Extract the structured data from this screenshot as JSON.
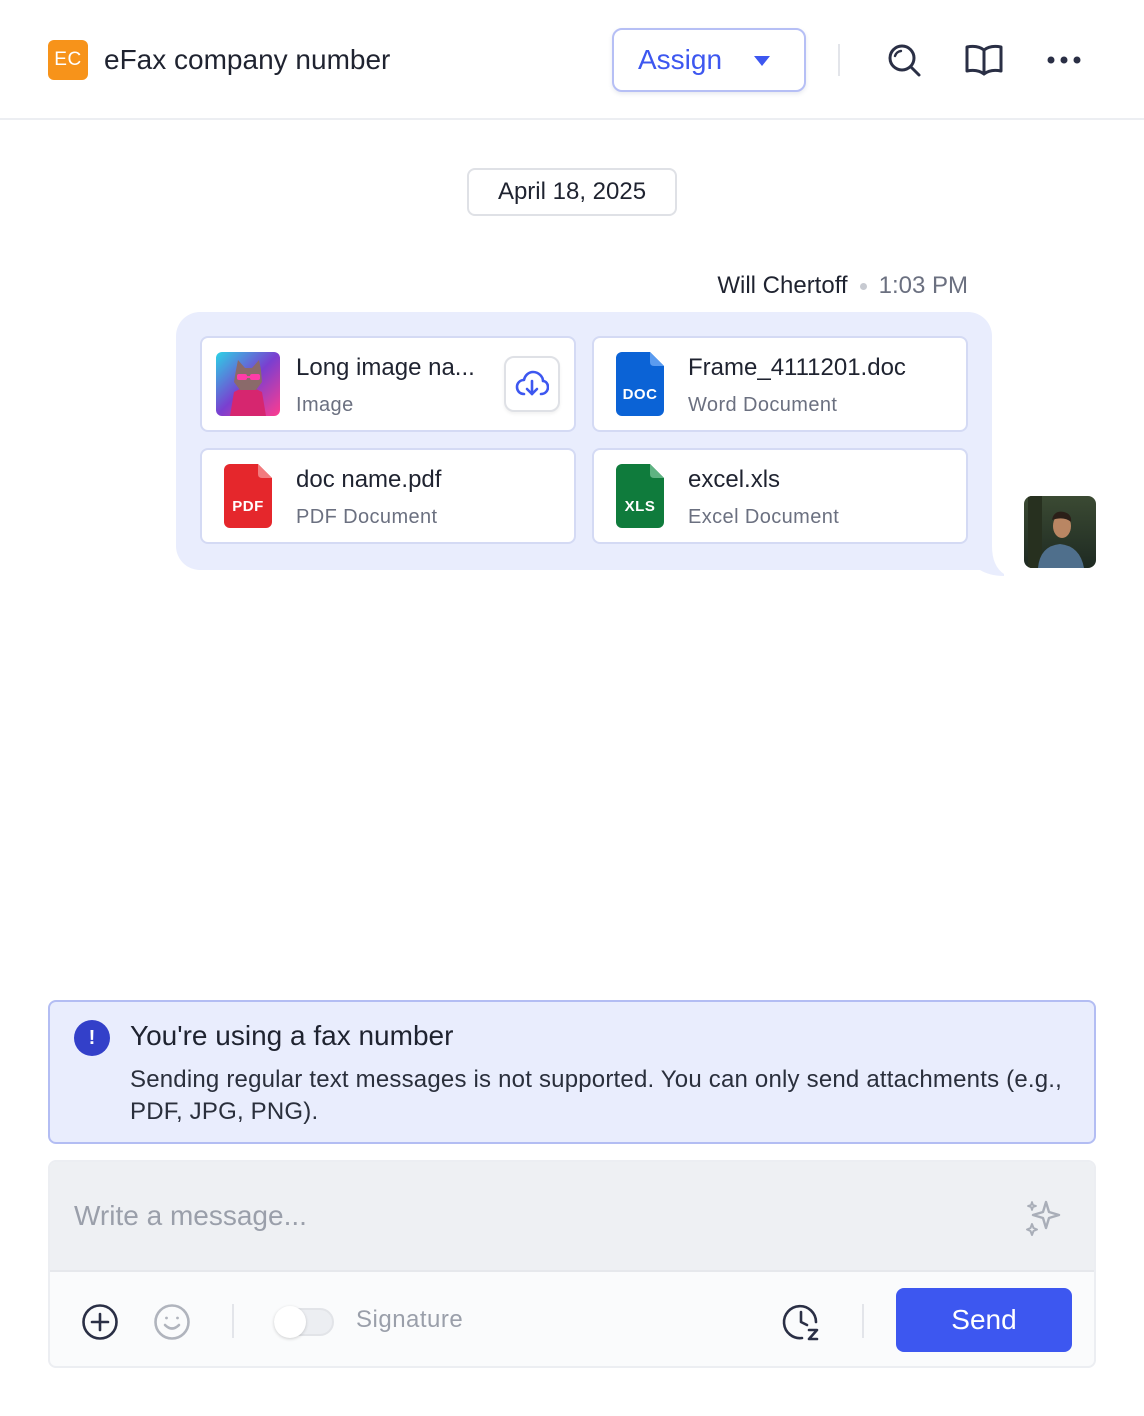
{
  "header": {
    "badge": "EC",
    "title": "eFax company number",
    "assign_label": "Assign",
    "colors": {
      "badge": "#f7931a",
      "accent": "#3d57f0"
    }
  },
  "conversation": {
    "date": "April 18, 2025",
    "message": {
      "sender": "Will Chertoff",
      "time": "1:03 PM",
      "attachments": [
        {
          "name": "Long image na...",
          "type": "Image",
          "icon": "image-thumbnail"
        },
        {
          "name": "Frame_4111201.doc",
          "type": "Word Document",
          "icon": "doc-file-icon",
          "tag": "DOC",
          "color": "#0b63d6"
        },
        {
          "name": "doc name.pdf",
          "type": "PDF Document",
          "icon": "pdf-file-icon",
          "tag": "PDF",
          "color": "#e5272c"
        },
        {
          "name": "excel.xls",
          "type": "Excel Document",
          "icon": "xls-file-icon",
          "tag": "XLS",
          "color": "#0f7b3c"
        }
      ]
    }
  },
  "notice": {
    "icon": "!",
    "title": "You're using a fax number",
    "body": "Sending regular text messages is not supported. You can only send attachments (e.g., PDF, JPG, PNG)."
  },
  "composer": {
    "placeholder": "Write a message...",
    "signature_label": "Signature",
    "signature_enabled": false,
    "send_label": "Send"
  }
}
